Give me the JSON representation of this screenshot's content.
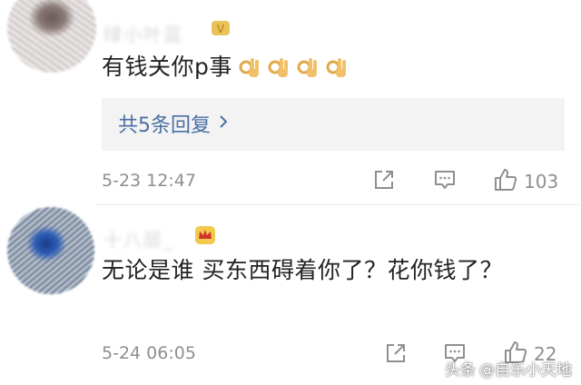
{
  "comments": [
    {
      "username": "绿小叶蓝",
      "text": "有钱关你p事",
      "reactions": [
        "ok-hand-emoji",
        "ok-hand-emoji",
        "ok-hand-emoji",
        "ok-hand-emoji"
      ],
      "reply_label": "共5条回复",
      "timestamp": "5-23 12:47",
      "likes": "103"
    },
    {
      "username": "十八层_",
      "text": "无论是谁  买东西碍着你了？花你钱了？",
      "timestamp": "5-24 06:05",
      "likes": "22"
    }
  ],
  "watermark": {
    "source": "头条",
    "account": "@自乐小天地"
  },
  "colors": {
    "link": "#4a6fa5",
    "meta": "#8f8f8f",
    "reply_bg": "#f3f3f3",
    "text": "#222222"
  },
  "icons": [
    "share-icon",
    "comment-icon",
    "thumbs-up-icon",
    "vip-badge-icon",
    "crown-badge-icon",
    "chevron-right-icon"
  ]
}
